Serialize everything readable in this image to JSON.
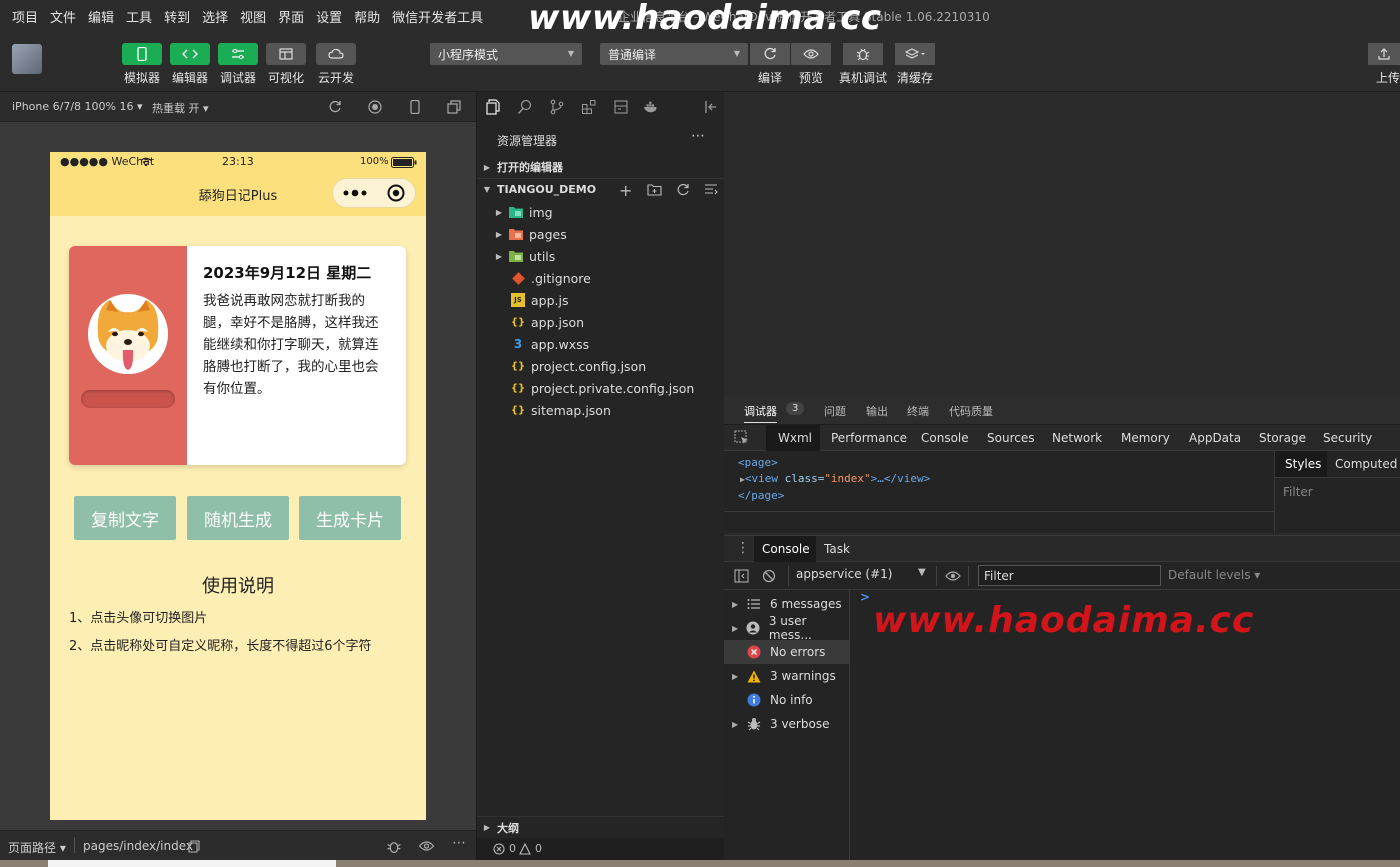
{
  "menu": [
    "项目",
    "文件",
    "编辑",
    "工具",
    "转到",
    "选择",
    "视图",
    "界面",
    "设置",
    "帮助",
    "微信开发者工具"
  ],
  "window_title": "企业信息平台 - WeChatDev 微信开发者工具 Stable 1.06.2210310",
  "watermark": "www.haodaima.cc",
  "toolbar": {
    "buttons": [
      "模拟器",
      "编辑器",
      "调试器",
      "可视化",
      "云开发"
    ],
    "mode_select": "小程序模式",
    "compile_select": "普通编译",
    "actions": [
      "编译",
      "预览",
      "真机调试",
      "清缓存"
    ],
    "upload": "上传"
  },
  "simulator": {
    "device": "iPhone 6/7/8 100% 16",
    "hot_reload": "热重载 开",
    "status_carrier": "●●●●● WeChat",
    "status_time": "23:13",
    "status_battery": "100%",
    "nav_title": "舔狗日记Plus",
    "card_date": "2023年9月12日 星期二",
    "card_text": "我爸说再敢网恋就打断我的腿，幸好不是胳膊，这样我还能继续和你打字聊天，就算连胳膊也打断了，我的心里也会有你位置。",
    "btn_copy": "复制文字",
    "btn_random": "随机生成",
    "btn_card": "生成卡片",
    "usage_title": "使用说明",
    "usage_1": "1、点击头像可切换图片",
    "usage_2": "2、点击昵称处可自定义昵称，长度不得超过6个字符",
    "footer_path_label": "页面路径",
    "footer_path": "pages/index/index"
  },
  "explorer": {
    "title": "资源管理器",
    "open_editors": "打开的编辑器",
    "project": "TIANGOU_DEMO",
    "folders": [
      "img",
      "pages",
      "utils"
    ],
    "files": [
      ".gitignore",
      "app.js",
      "app.json",
      "app.wxss",
      "project.config.json",
      "project.private.config.json",
      "sitemap.json"
    ],
    "outline": "大纲",
    "status": "0",
    "status_warn": "0"
  },
  "devtools": {
    "top_tabs": [
      "调试器",
      "问题",
      "输出",
      "终端",
      "代码质量"
    ],
    "debugger_count": "3",
    "tabs": [
      "Wxml",
      "Performance",
      "Console",
      "Sources",
      "Network",
      "Memory",
      "AppData",
      "Storage",
      "Security"
    ],
    "wxml_line1": "<page>",
    "wxml_line2_tag": "<view",
    "wxml_line2_attr": " class=",
    "wxml_line2_val": "\"index\"",
    "wxml_line2_rest": ">…</view>",
    "wxml_line3": "</page>",
    "styles_tab": "Styles",
    "computed_tab": "Computed",
    "styles_filter": "Filter",
    "console_tabs": [
      "Console",
      "Task"
    ],
    "context": "appservice (#1)",
    "filter_placeholder": "Filter",
    "levels": "Default levels",
    "sidebar": [
      "6 messages",
      "3 user mess...",
      "No errors",
      "3 warnings",
      "No info",
      "3 verbose"
    ],
    "prompt": ">"
  },
  "colors": {
    "green": "#1aad54",
    "yellow_nav": "#fbe07d",
    "phone_bg": "#fdeeb3",
    "card_red": "#e0675e",
    "btn_teal": "#8fbfa8",
    "watermark_red": "#d2141b"
  }
}
